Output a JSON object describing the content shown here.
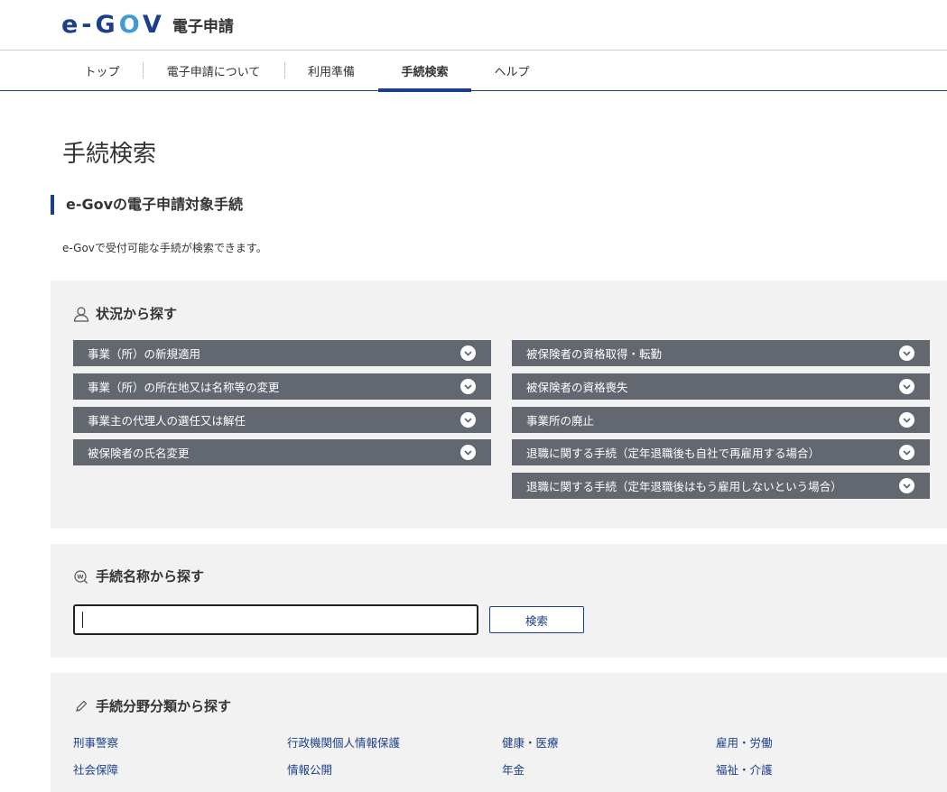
{
  "header": {
    "logo_text": "e-GOV",
    "service_name": "電子申請"
  },
  "nav": {
    "items": [
      {
        "label": "トップ"
      },
      {
        "label": "電子申請について"
      },
      {
        "label": "利用準備"
      },
      {
        "label": "手続検索",
        "active": true
      },
      {
        "label": "ヘルプ"
      }
    ]
  },
  "page": {
    "title": "手続検索",
    "section_title": "e-Govの電子申請対象手続",
    "lead": "e-Govで受付可能な手続が検索できます。"
  },
  "situation": {
    "heading": "状況から探す",
    "icon": "person-icon",
    "items_left": [
      "事業（所）の新規適用",
      "事業（所）の所在地又は名称等の変更",
      "事業主の代理人の選任又は解任",
      "被保険者の氏名変更"
    ],
    "items_right": [
      "被保険者の資格取得・転勤",
      "被保険者の資格喪失",
      "事業所の廃止",
      "退職に関する手続（定年退職後も自社で再雇用する場合）",
      "退職に関する手続（定年退職後はもう雇用しないという場合）"
    ]
  },
  "name_search": {
    "heading": "手続名称から探す",
    "icon": "word-search-icon",
    "input_value": "",
    "button_label": "検索"
  },
  "field_search": {
    "heading": "手続分野分類から探す",
    "icon": "pencil-icon",
    "rows": [
      [
        "刑事警察",
        "行政機関個人情報保護",
        "健康・医療",
        "雇用・労働"
      ],
      [
        "社会保障",
        "情報公開",
        "年金",
        "福祉・介護"
      ]
    ]
  },
  "colors": {
    "brand": "#1c3f8a",
    "accordion_bg": "#636770",
    "panel_bg": "#f2f2f2"
  }
}
